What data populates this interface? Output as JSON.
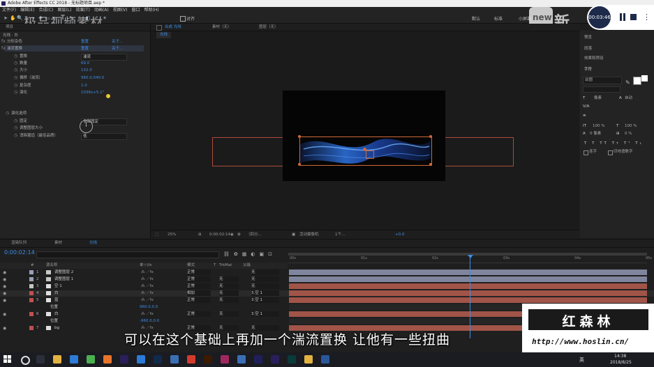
{
  "window": {
    "title": "Adobe After Effects CC 2018 - 无标题项目.aep *"
  },
  "menu": [
    "文件(F)",
    "编辑(E)",
    "合成(C)",
    "图层(L)",
    "效果(T)",
    "动画(A)",
    "视图(V)",
    "窗口",
    "帮助(H)"
  ],
  "toolbar": {
    "snap_label": "对齐",
    "workspaces": [
      "默认",
      "标准",
      "小屏幕"
    ]
  },
  "recording": {
    "time": "00:03:46"
  },
  "watermarks": {
    "top_left": "极品视频素材",
    "top_right": "新片场",
    "brand_cn": "红森林",
    "brand_url": "http://www.hoslin.cn/"
  },
  "effects_panel": {
    "tab": "项目",
    "layer_path": "光线 · 白",
    "rows": [
      {
        "label": "分形杂色",
        "value": "重置",
        "extra": "关于..."
      },
      {
        "label": "湍流置换",
        "value": "重置",
        "extra": "关于..."
      },
      {
        "label": "置换",
        "value": "湍流"
      },
      {
        "label": "数量",
        "value": "69.0"
      },
      {
        "label": "大小",
        "value": "132.0"
      },
      {
        "label": "偏移（湍流）",
        "value": "960.0,540.0"
      },
      {
        "label": "复杂度",
        "value": "1.0"
      },
      {
        "label": "演化",
        "value": "1036x+5.1°"
      },
      {
        "label": "演化选项",
        "value": ""
      },
      {
        "label": "固定",
        "value": "全部固定"
      },
      {
        "label": "调整图层大小",
        "value": ""
      },
      {
        "label": "消除锯齿（最佳品质）",
        "value": "低"
      }
    ]
  },
  "composition": {
    "tabs": [
      "合成 光线",
      "素材（无）",
      "图层（无）"
    ],
    "subtab": "光线",
    "zoom": "25%",
    "timecode": "0:00:02:14",
    "quality": "（四分...",
    "camera": "活动摄像机",
    "views": "1个...",
    "offset": "+0.0"
  },
  "right_panel": {
    "items": [
      "预览",
      "段落",
      "效果和预设"
    ],
    "character_title": "字符",
    "font_name": "幼圆",
    "stroke_label": "像素",
    "auto_label": "自动",
    "scale_v": "100 %",
    "scale_h": "100 %",
    "baseline": "0 像素",
    "tsume": "0 %",
    "ligature": "连字",
    "hindi": "印地语数字"
  },
  "timeline": {
    "tabs": [
      "渲染队列",
      "素材",
      "光线"
    ],
    "timecode": "0:00:02:14",
    "columns": [
      "#",
      "源名称",
      "单☆\\fx",
      "模式",
      "T",
      "TrkMat",
      "父级"
    ],
    "ruler": [
      "00s",
      "01s",
      "02s",
      "03s",
      "04s",
      "05s"
    ],
    "layers": [
      {
        "num": "1",
        "name": "调整图层 2",
        "mode": "正常",
        "trk": "",
        "parent": "无",
        "color": "#9aa0b8",
        "bar": "#7f859d"
      },
      {
        "num": "2",
        "name": "调整图层 1",
        "mode": "正常",
        "trk": "无",
        "parent": "无",
        "color": "#9aa0b8",
        "bar": "#7f859d"
      },
      {
        "num": "3",
        "name": "空 1",
        "mode": "正常",
        "trk": "无",
        "parent": "无",
        "color": "#c4c4c4",
        "bar": "#a15448"
      },
      {
        "num": "4",
        "name": "白",
        "mode": "相加",
        "trk": "无",
        "parent": "3.空 1",
        "color": "#c05050",
        "bar": "#a15448"
      },
      {
        "num": "5",
        "name": "蓝",
        "mode": "正常",
        "trk": "无",
        "parent": "3.空 1",
        "color": "#c05050",
        "bar": "#a15448"
      },
      {
        "num": "",
        "name": "位置",
        "mode": "",
        "trk": "",
        "parent": "",
        "value": "960.0,0.0",
        "color": "",
        "bar": ""
      },
      {
        "num": "6",
        "name": "白",
        "mode": "正常",
        "trk": "无",
        "parent": "3.空 1",
        "color": "#c05050",
        "bar": "#a15448"
      },
      {
        "num": "",
        "name": "位置",
        "mode": "",
        "trk": "",
        "parent": "",
        "value": "-960.0,0.0",
        "color": "",
        "bar": ""
      },
      {
        "num": "7",
        "name": "bg",
        "mode": "正常",
        "trk": "无",
        "parent": "无",
        "color": "#c05050",
        "bar": "#a15448"
      }
    ]
  },
  "subtitle": "可以在这个基础上再加一个湍流置换  让他有一些扭曲",
  "taskbar": {
    "apps": [
      {
        "name": "task-view",
        "color": "#2b2f3a"
      },
      {
        "name": "file-explorer",
        "color": "#e3b341"
      },
      {
        "name": "store",
        "color": "#2d7bd6"
      },
      {
        "name": "chrome",
        "color": "#4caf50"
      },
      {
        "name": "firefox",
        "color": "#e8742c"
      },
      {
        "name": "premiere",
        "color": "#2a1f5a"
      },
      {
        "name": "media",
        "color": "#2d7bd6"
      },
      {
        "name": "photoshop",
        "color": "#0f2a4a"
      },
      {
        "name": "photos",
        "color": "#3b6fb5"
      },
      {
        "name": "weibo",
        "color": "#d23b2b"
      },
      {
        "name": "illustrator",
        "color": "#3a1a00"
      },
      {
        "name": "arrow-app",
        "color": "#a02860"
      },
      {
        "name": "windows-app",
        "color": "#3b6fb5"
      },
      {
        "name": "aftereffects",
        "color": "#1f1f5c"
      },
      {
        "name": "premiere-2",
        "color": "#2a1f5a"
      },
      {
        "name": "audition",
        "color": "#0a3a3a"
      },
      {
        "name": "explorer-2",
        "color": "#e3b341"
      },
      {
        "name": "word",
        "color": "#2b579a"
      }
    ],
    "lang": "英",
    "time": "14:38",
    "date": "2018/8/25"
  },
  "colors": {
    "accent_blue": "#3d8ee6",
    "comp_bg": "#050505",
    "layer_red": "#a15448",
    "layer_gray": "#7f859d"
  }
}
